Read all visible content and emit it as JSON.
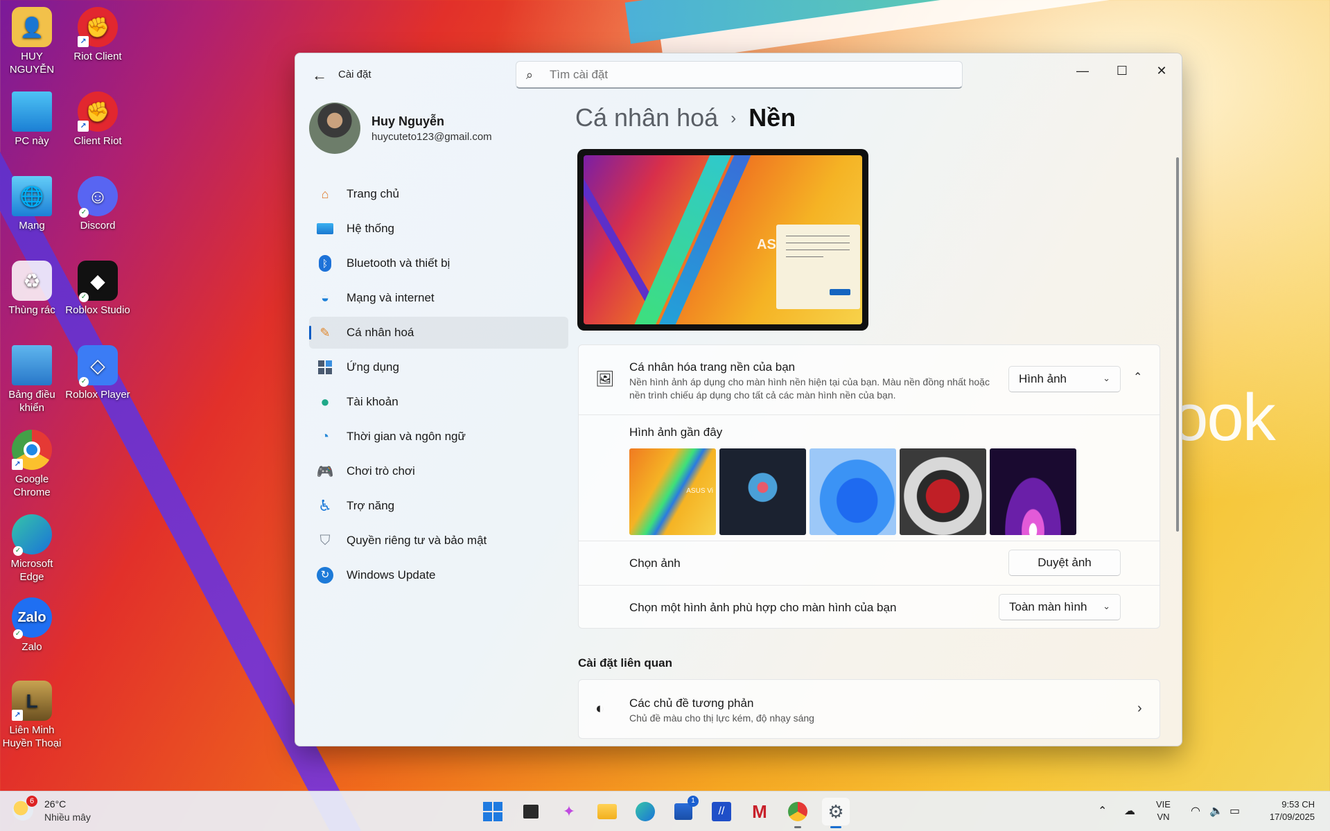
{
  "desktop": {
    "icons": [
      {
        "label": "HUY NGUYỄN",
        "icon": "user-folder-icon"
      },
      {
        "label": "Riot Client",
        "icon": "riot-client-icon"
      },
      {
        "label": "PC này",
        "icon": "this-pc-icon"
      },
      {
        "label": "Client Riot",
        "icon": "riot-client-icon"
      },
      {
        "label": "Mạng",
        "icon": "network-icon"
      },
      {
        "label": "Discord",
        "icon": "discord-icon"
      },
      {
        "label": "Thùng rác",
        "icon": "recycle-bin-icon"
      },
      {
        "label": "Roblox Studio",
        "icon": "roblox-studio-icon"
      },
      {
        "label": "Bảng điều khiển",
        "icon": "control-panel-icon"
      },
      {
        "label": "Roblox Player",
        "icon": "roblox-player-icon"
      },
      {
        "label": "Google Chrome",
        "icon": "chrome-icon"
      },
      {
        "label": "Microsoft Edge",
        "icon": "edge-icon"
      },
      {
        "label": "Zalo",
        "icon": "zalo-icon"
      },
      {
        "label": "Liên Minh Huyền Thoại",
        "icon": "league-of-legends-icon"
      }
    ],
    "wallpaper_text": "ook"
  },
  "window": {
    "app_title": "Cài đặt",
    "search_placeholder": "Tìm cài đặt",
    "controls": {
      "minimize": "—",
      "maximize": "☐",
      "close": "✕"
    }
  },
  "profile": {
    "name": "Huy Nguyễn",
    "email": "huycuteto123@gmail.com"
  },
  "nav": {
    "items": [
      {
        "label": "Trang chủ",
        "icon": "home-icon"
      },
      {
        "label": "Hệ thống",
        "icon": "system-icon"
      },
      {
        "label": "Bluetooth và thiết bị",
        "icon": "bluetooth-icon"
      },
      {
        "label": "Mạng và internet",
        "icon": "wifi-icon"
      },
      {
        "label": "Cá nhân hoá",
        "icon": "brush-icon",
        "active": true
      },
      {
        "label": "Ứng dụng",
        "icon": "apps-icon"
      },
      {
        "label": "Tài khoản",
        "icon": "account-icon"
      },
      {
        "label": "Thời gian và ngôn ngữ",
        "icon": "time-language-icon"
      },
      {
        "label": "Chơi trò chơi",
        "icon": "gaming-icon"
      },
      {
        "label": "Trợ năng",
        "icon": "accessibility-icon"
      },
      {
        "label": "Quyền riêng tư và bảo mật",
        "icon": "shield-icon"
      },
      {
        "label": "Windows Update",
        "icon": "update-icon"
      }
    ]
  },
  "breadcrumb": {
    "parent": "Cá nhân hoá",
    "separator": "›",
    "current": "Nền"
  },
  "preview": {
    "brand_text": "ASU"
  },
  "background_card": {
    "title": "Cá nhân hóa trang nền của bạn",
    "description": "Nền hình ảnh áp dụng cho màn hình nền hiện tại của bạn. Màu nền đồng nhất hoặc nền trình chiếu áp dụng cho tất cả các màn hình nền của bạn.",
    "type_value": "Hình ảnh",
    "recent_label": "Hình ảnh gần đây",
    "thumb_caption": "ASUS Vi",
    "choose_label": "Chọn ảnh",
    "browse_button": "Duyệt ảnh",
    "fit_label": "Chọn một hình ảnh phù hợp cho màn hình của bạn",
    "fit_value": "Toàn màn hình"
  },
  "related": {
    "heading": "Cài đặt liên quan",
    "contrast_title": "Các chủ đề tương phản",
    "contrast_desc": "Chủ đề màu cho thị lực kém, độ nhạy sáng"
  },
  "taskbar": {
    "weather_temp": "26°C",
    "weather_cond": "Nhiều mây",
    "weather_badge": "6",
    "store_badge": "1",
    "lang_top": "VIE",
    "lang_bottom": "VN",
    "time": "9:53 CH",
    "date": "17/09/2025"
  }
}
